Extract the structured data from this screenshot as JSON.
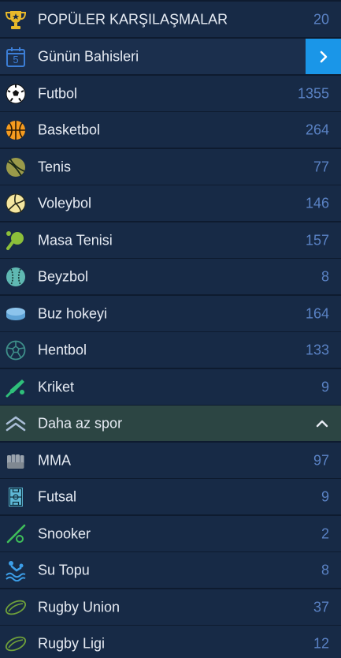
{
  "rows": [
    {
      "label": "POPÜLER KARŞILAŞMALAR",
      "count": "20",
      "icon": "trophy-icon"
    },
    {
      "label": "Günün Bahisleri",
      "icon": "calendar-icon",
      "calendar_day": "5"
    },
    {
      "label": "Futbol",
      "count": "1355",
      "icon": "soccer-ball-icon"
    },
    {
      "label": "Basketbol",
      "count": "264",
      "icon": "basketball-icon"
    },
    {
      "label": "Tenis",
      "count": "77",
      "icon": "tennis-ball-icon"
    },
    {
      "label": "Voleybol",
      "count": "146",
      "icon": "volleyball-icon"
    },
    {
      "label": "Masa Tenisi",
      "count": "157",
      "icon": "table-tennis-icon"
    },
    {
      "label": "Beyzbol",
      "count": "8",
      "icon": "baseball-icon"
    },
    {
      "label": "Buz hokeyi",
      "count": "164",
      "icon": "hockey-puck-icon"
    },
    {
      "label": "Hentbol",
      "count": "133",
      "icon": "handball-icon"
    },
    {
      "label": "Kriket",
      "count": "9",
      "icon": "cricket-icon"
    },
    {
      "label": "Daha az spor",
      "icon": "double-chevron-up-icon"
    },
    {
      "label": "MMA",
      "count": "97",
      "icon": "fist-icon"
    },
    {
      "label": "Futsal",
      "count": "9",
      "icon": "futsal-field-icon"
    },
    {
      "label": "Snooker",
      "count": "2",
      "icon": "snooker-cue-icon"
    },
    {
      "label": "Su Topu",
      "count": "8",
      "icon": "swimmer-icon"
    },
    {
      "label": "Rugby Union",
      "count": "37",
      "icon": "rugby-ball-icon"
    },
    {
      "label": "Rugby Ligi",
      "count": "12",
      "icon": "rugby-ball-icon"
    }
  ],
  "colors": {
    "background": "#0e1b2f",
    "row": "#172a46",
    "row_highlight": "#1b2f4d",
    "collapse_row": "#2c4543",
    "count_text": "#5a82c4",
    "accent_button": "#1a96e8"
  }
}
